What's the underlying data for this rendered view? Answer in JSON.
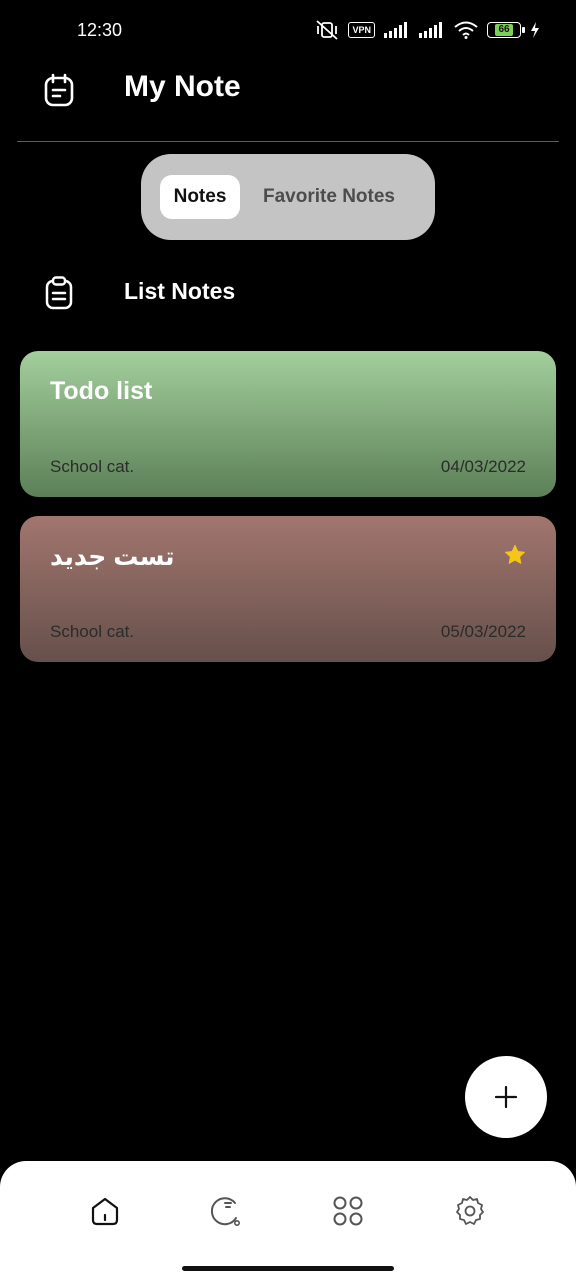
{
  "status_bar": {
    "time": "12:30",
    "vpn_label": "VPN",
    "battery_level": "66",
    "icons": [
      "mute-vibrate-icon",
      "vpn-icon",
      "signal-icon",
      "signal-icon",
      "wifi-icon",
      "battery-icon",
      "charging-icon"
    ]
  },
  "header": {
    "title": "My Note",
    "icon": "notepad-icon"
  },
  "tabs": [
    {
      "label": "Notes",
      "active": true
    },
    {
      "label": "Favorite Notes",
      "active": false
    }
  ],
  "section": {
    "title": "List Notes",
    "icon": "clipboard-icon"
  },
  "notes": [
    {
      "title": "Todo list",
      "category": "School cat.",
      "date": "04/03/2022",
      "favorite": false,
      "color": "#8fb489"
    },
    {
      "title": "تست جدید",
      "category": "School cat.",
      "date": "05/03/2022",
      "favorite": true,
      "color": "#8a645d"
    }
  ],
  "fab": {
    "icon": "plus-icon"
  },
  "bottom_nav": [
    {
      "icon": "home-icon",
      "active": true
    },
    {
      "icon": "reminder-icon",
      "active": false
    },
    {
      "icon": "grid-icon",
      "active": false
    },
    {
      "icon": "settings-icon",
      "active": false
    }
  ],
  "colors": {
    "background": "#000000",
    "star": "#f5c518",
    "tab_bg": "#c4c4c4"
  }
}
